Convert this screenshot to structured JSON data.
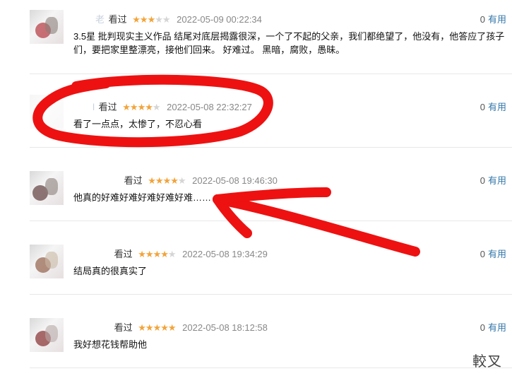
{
  "reviews": [
    {
      "name": "老",
      "status": "看过",
      "stars_filled": 3,
      "stars_total": 5,
      "time": "2022-05-09 00:22:34",
      "useful_count": "0",
      "useful_label": "有用",
      "text": "3.5星 批判现实主义作品 结尾对底层揭露很深，一个了不起的父亲，我们都绝望了，他没有，他答应了孩子们，要把家里整漂亮，接他们回来。 好难过。 黑暗，腐败，愚昧。"
    },
    {
      "name": "l",
      "status": "看过",
      "stars_filled": 4,
      "stars_total": 5,
      "time": "2022-05-08 22:32:27",
      "useful_count": "0",
      "useful_label": "有用",
      "text": "看了一点点，太惨了，不忍心看"
    },
    {
      "name": "",
      "status": "看过",
      "stars_filled": 4,
      "stars_total": 5,
      "time": "2022-05-08 19:46:30",
      "useful_count": "0",
      "useful_label": "有用",
      "text": "他真的好难好难好难好难好难……"
    },
    {
      "name": "",
      "status": "看过",
      "stars_filled": 4,
      "stars_total": 5,
      "time": "2022-05-08 19:34:29",
      "useful_count": "0",
      "useful_label": "有用",
      "text": "结局真的很真实了"
    },
    {
      "name": "",
      "status": "看过",
      "stars_filled": 5,
      "stars_total": 5,
      "time": "2022-05-08 18:12:58",
      "useful_count": "0",
      "useful_label": "有用",
      "text": "我好想花钱帮助他"
    }
  ],
  "watermark": "較叉",
  "annotation_color": "#ee1111",
  "star_color": "#f2a43a"
}
